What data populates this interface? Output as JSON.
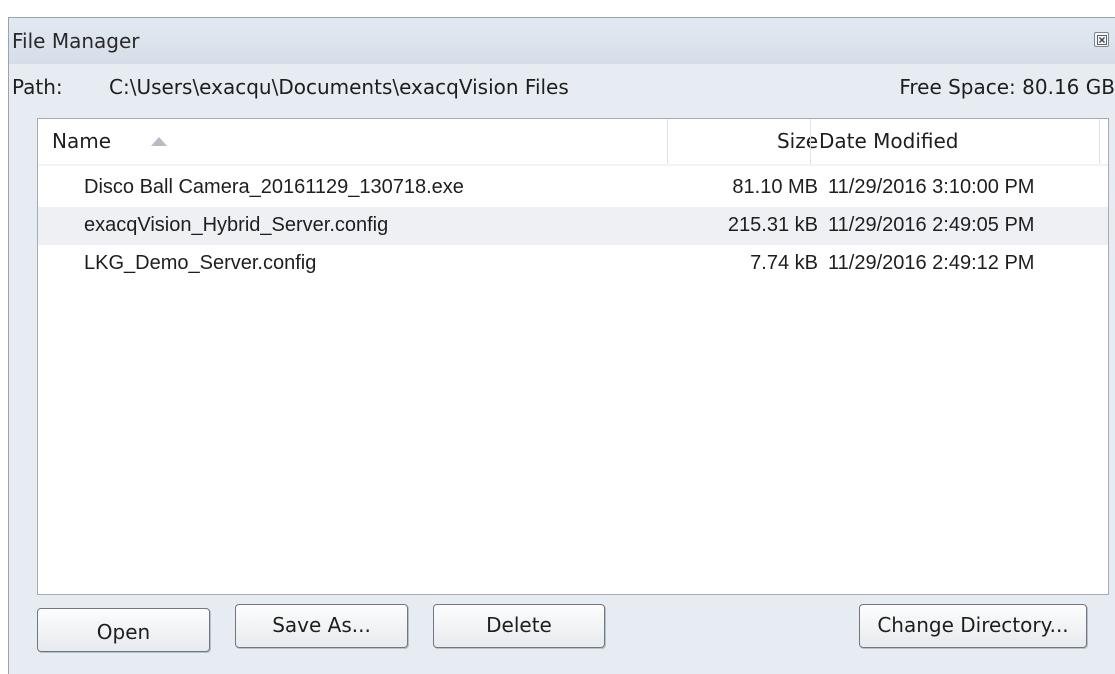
{
  "window": {
    "title": "File Manager",
    "close_icon": "close-icon"
  },
  "path": {
    "label": "Path:",
    "value": "C:\\Users\\exacqu\\Documents\\exacqVision Files",
    "free_space": "Free Space: 80.16 GB"
  },
  "columns": {
    "name": "Name",
    "size": "Size",
    "date": "Date Modified",
    "sort_icon": "sort-ascending-icon"
  },
  "files": [
    {
      "name": "Disco Ball Camera_20161129_130718.exe",
      "size": "81.10 MB",
      "date": "11/29/2016 3:10:00 PM"
    },
    {
      "name": "exacqVision_Hybrid_Server.config",
      "size": "215.31 kB",
      "date": "11/29/2016 2:49:05 PM"
    },
    {
      "name": "LKG_Demo_Server.config",
      "size": "7.74 kB",
      "date": "11/29/2016 2:49:12 PM"
    }
  ],
  "buttons": {
    "open": "Open",
    "save_as": "Save As...",
    "delete": "Delete",
    "change_directory": "Change Directory..."
  }
}
